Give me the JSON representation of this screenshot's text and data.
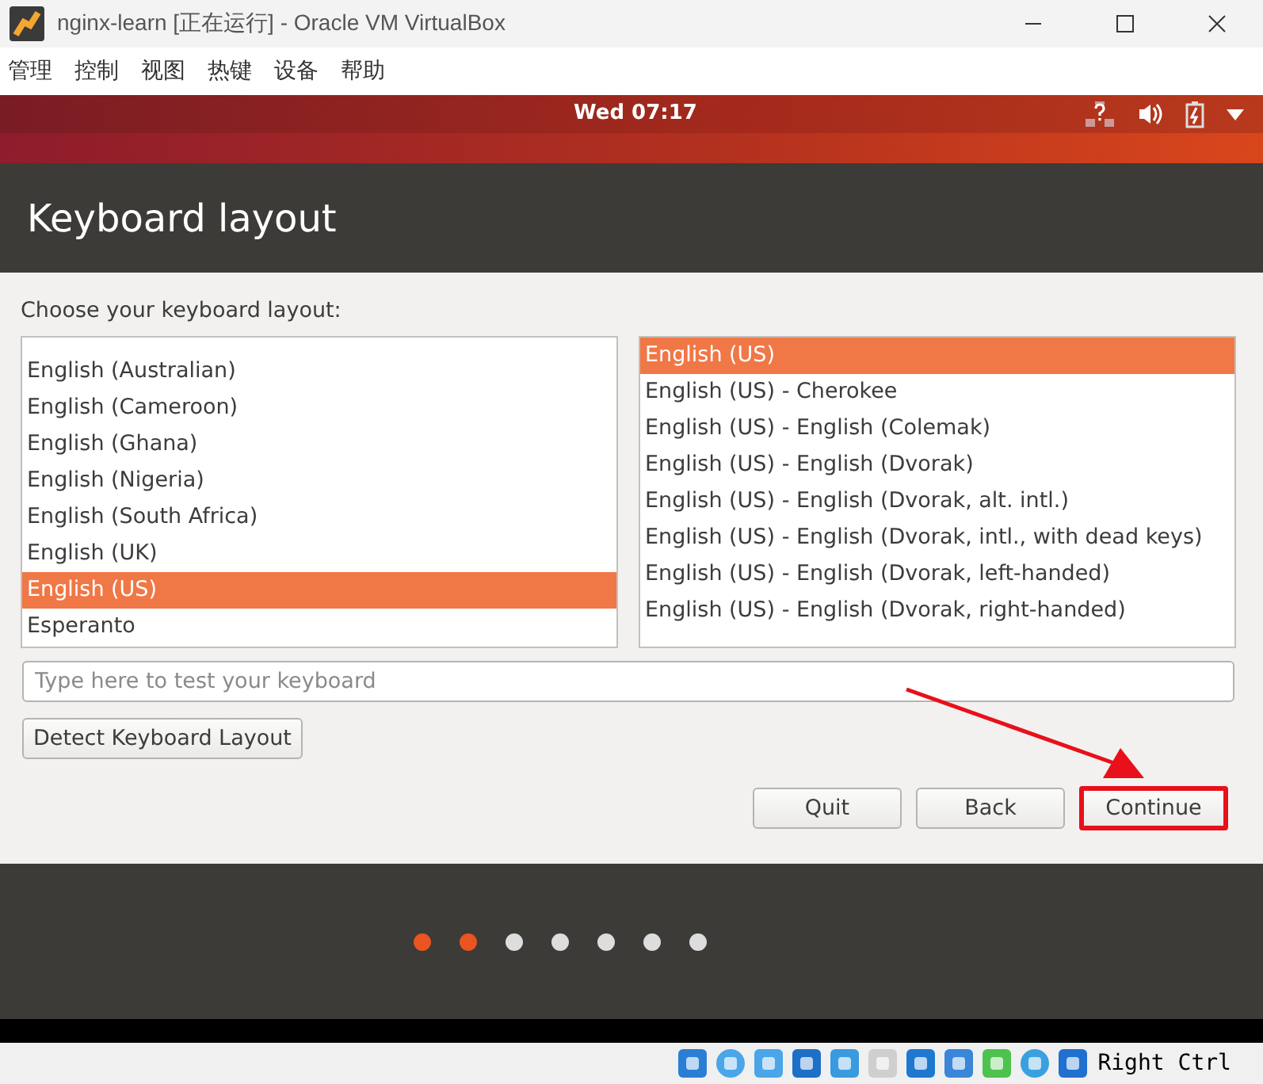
{
  "window": {
    "title": "nginx-learn [正在运行] - Oracle VM VirtualBox"
  },
  "menu": [
    "管理",
    "控制",
    "视图",
    "热键",
    "设备",
    "帮助"
  ],
  "top_panel": {
    "clock": "Wed 07:17"
  },
  "header": {
    "title": "Keyboard layout"
  },
  "prompt": "Choose your keyboard layout:",
  "layouts": [
    {
      "label": "English (Australian)",
      "selected": false
    },
    {
      "label": "English (Cameroon)",
      "selected": false
    },
    {
      "label": "English (Ghana)",
      "selected": false
    },
    {
      "label": "English (Nigeria)",
      "selected": false
    },
    {
      "label": "English (South Africa)",
      "selected": false
    },
    {
      "label": "English (UK)",
      "selected": false
    },
    {
      "label": "English (US)",
      "selected": true
    },
    {
      "label": "Esperanto",
      "selected": false
    }
  ],
  "variants": [
    {
      "label": "English (US)",
      "selected": true
    },
    {
      "label": "English (US) - Cherokee",
      "selected": false
    },
    {
      "label": "English (US) - English (Colemak)",
      "selected": false
    },
    {
      "label": "English (US) - English (Dvorak)",
      "selected": false
    },
    {
      "label": "English (US) - English (Dvorak, alt. intl.)",
      "selected": false
    },
    {
      "label": "English (US) - English (Dvorak, intl., with dead keys)",
      "selected": false
    },
    {
      "label": "English (US) - English (Dvorak, left-handed)",
      "selected": false
    },
    {
      "label": "English (US) - English (Dvorak, right-handed)",
      "selected": false
    }
  ],
  "test_field": {
    "placeholder": "Type here to test your keyboard"
  },
  "detect_button": "Detect Keyboard Layout",
  "buttons": [
    {
      "label": "Quit",
      "highlighted": false
    },
    {
      "label": "Back",
      "highlighted": false
    },
    {
      "label": "Continue",
      "highlighted": true
    }
  ],
  "progress_dots": [
    {
      "done": true
    },
    {
      "done": true
    },
    {
      "done": false
    },
    {
      "done": false
    },
    {
      "done": false
    },
    {
      "done": false
    },
    {
      "done": false
    }
  ],
  "status_bar": {
    "host_key": "Right Ctrl"
  }
}
